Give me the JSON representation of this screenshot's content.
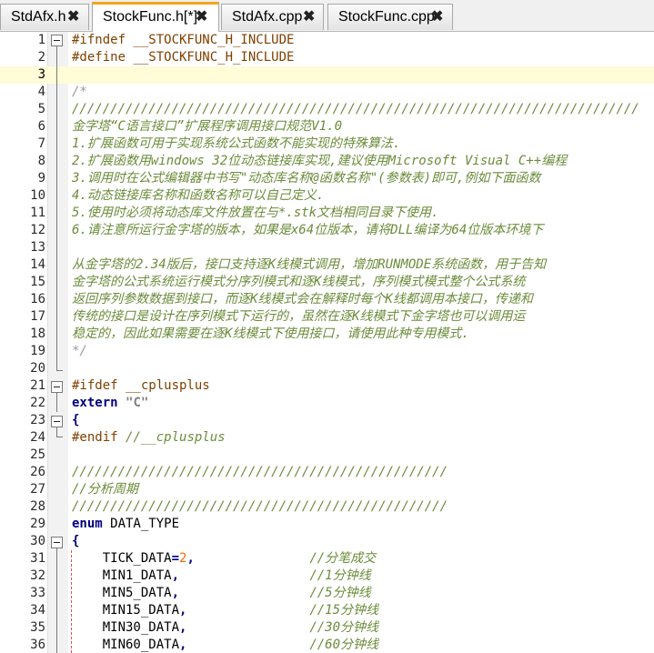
{
  "tabs": [
    {
      "label": "StdAfx.h",
      "active": false
    },
    {
      "label": "StockFunc.h[*]",
      "active": true
    },
    {
      "label": "StdAfx.cpp",
      "active": false
    },
    {
      "label": "StockFunc.cpp",
      "active": false
    }
  ],
  "close_glyph": "✖",
  "current_line": 3,
  "lines": [
    {
      "n": "1",
      "segs": [
        [
          "pp",
          "#ifndef __STOCKFUNC_H_INCLUDE"
        ]
      ]
    },
    {
      "n": "2",
      "segs": [
        [
          "pp",
          "#define __STOCKFUNC_H_INCLUDE"
        ]
      ]
    },
    {
      "n": "3",
      "segs": []
    },
    {
      "n": "4",
      "segs": [
        [
          "cm2",
          "/*"
        ]
      ]
    },
    {
      "n": "5",
      "segs": [
        [
          "cm",
          "//////////////////////////////////////////////////////////////////////////"
        ]
      ]
    },
    {
      "n": "6",
      "segs": [
        [
          "cm",
          "金字塔“C语言接口”扩展程序调用接口规范V1.0"
        ]
      ]
    },
    {
      "n": "7",
      "segs": [
        [
          "cm",
          "1.扩展函数可用于实现系统公式函数不能实现的特殊算法."
        ]
      ]
    },
    {
      "n": "8",
      "segs": [
        [
          "cm",
          "2.扩展函数用windows 32位动态链接库实现,建议使用Microsoft Visual C++编程"
        ]
      ]
    },
    {
      "n": "9",
      "segs": [
        [
          "cm",
          "3.调用时在公式编辑器中书写\"动态库名称@函数名称\"(参数表)即可,例如下面函数"
        ]
      ]
    },
    {
      "n": "10",
      "segs": [
        [
          "cm",
          "4.动态链接库名称和函数名称可以自己定义."
        ]
      ]
    },
    {
      "n": "11",
      "segs": [
        [
          "cm",
          "5.使用时必须将动态库文件放置在与*.stk文档相同目录下使用."
        ]
      ]
    },
    {
      "n": "12",
      "segs": [
        [
          "cm",
          "6.请注意所运行金字塔的版本，如果是x64位版本，请将DLL编译为64位版本环境下"
        ]
      ]
    },
    {
      "n": "13",
      "segs": []
    },
    {
      "n": "14",
      "segs": [
        [
          "cm",
          "从金字塔的2.34版后，接口支持逐K线模式调用，增加RUNMODE系统函数，用于告知"
        ]
      ]
    },
    {
      "n": "15",
      "segs": [
        [
          "cm",
          "金字塔的公式系统运行模式分序列模式和逐K线模式，序列模式模式整个公式系统"
        ]
      ]
    },
    {
      "n": "16",
      "segs": [
        [
          "cm",
          "返回序列参数数据到接口，而逐K线模式会在解释时每个K线都调用本接口，传递和"
        ]
      ]
    },
    {
      "n": "17",
      "segs": [
        [
          "cm",
          "传统的接口是设计在序列模式下运行的，虽然在逐K线模式下金字塔也可以调用运"
        ]
      ]
    },
    {
      "n": "18",
      "segs": [
        [
          "cm",
          "稳定的，因此如果需要在逐K线模式下使用接口，请使用此种专用模式."
        ]
      ]
    },
    {
      "n": "19",
      "segs": [
        [
          "cm2",
          "*/"
        ]
      ]
    },
    {
      "n": "20",
      "segs": []
    },
    {
      "n": "21",
      "segs": [
        [
          "pp",
          "#ifdef __cplusplus"
        ]
      ]
    },
    {
      "n": "22",
      "segs": [
        [
          "kw",
          "extern"
        ],
        [
          "txt",
          " "
        ],
        [
          "str",
          "\"C\""
        ]
      ]
    },
    {
      "n": "23",
      "segs": [
        [
          "op",
          "{"
        ]
      ]
    },
    {
      "n": "24",
      "segs": [
        [
          "pp",
          "#endif"
        ],
        [
          "txt",
          " "
        ],
        [
          "cm",
          "//__cplusplus"
        ]
      ]
    },
    {
      "n": "25",
      "segs": []
    },
    {
      "n": "26",
      "segs": [
        [
          "cm",
          "/////////////////////////////////////////////////"
        ]
      ]
    },
    {
      "n": "27",
      "segs": [
        [
          "cm",
          "//分析周期"
        ]
      ]
    },
    {
      "n": "28",
      "segs": [
        [
          "cm",
          "/////////////////////////////////////////////////"
        ]
      ]
    },
    {
      "n": "29",
      "segs": [
        [
          "kw",
          "enum"
        ],
        [
          "txt",
          " DATA_TYPE"
        ]
      ]
    },
    {
      "n": "30",
      "segs": [
        [
          "op",
          "{"
        ]
      ]
    },
    {
      "n": "31",
      "segs": [
        [
          "txt",
          "    TICK_DATA"
        ],
        [
          "op",
          "="
        ],
        [
          "num",
          "2"
        ],
        [
          "op",
          ","
        ],
        [
          "txt",
          "               "
        ],
        [
          "cm",
          "//分笔成交"
        ]
      ]
    },
    {
      "n": "32",
      "segs": [
        [
          "txt",
          "    MIN1_DATA"
        ],
        [
          "op",
          ","
        ],
        [
          "txt",
          "                 "
        ],
        [
          "cm",
          "//1分钟线"
        ]
      ]
    },
    {
      "n": "33",
      "segs": [
        [
          "txt",
          "    MIN5_DATA"
        ],
        [
          "op",
          ","
        ],
        [
          "txt",
          "                 "
        ],
        [
          "cm",
          "//5分钟线"
        ]
      ]
    },
    {
      "n": "34",
      "segs": [
        [
          "txt",
          "    MIN15_DATA"
        ],
        [
          "op",
          ","
        ],
        [
          "txt",
          "                "
        ],
        [
          "cm",
          "//15分钟线"
        ]
      ]
    },
    {
      "n": "35",
      "segs": [
        [
          "txt",
          "    MIN30_DATA"
        ],
        [
          "op",
          ","
        ],
        [
          "txt",
          "                "
        ],
        [
          "cm",
          "//30分钟线"
        ]
      ]
    },
    {
      "n": "36",
      "segs": [
        [
          "txt",
          "    MIN60_DATA"
        ],
        [
          "op",
          ","
        ],
        [
          "txt",
          "                "
        ],
        [
          "cm",
          "//60分钟线"
        ]
      ]
    }
  ]
}
